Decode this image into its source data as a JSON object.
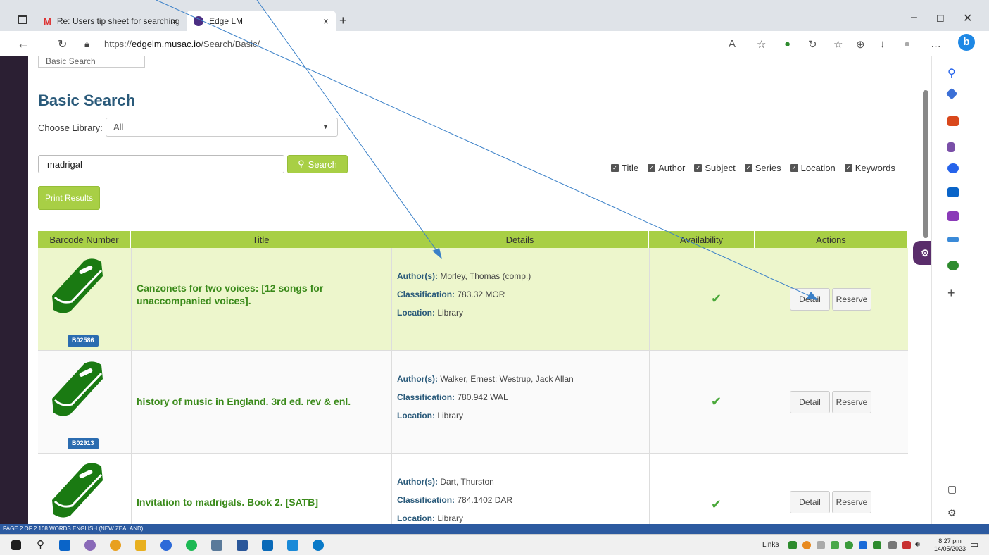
{
  "browser": {
    "tabs": [
      {
        "label": "Re: Users tip sheet for searching",
        "close": "×"
      },
      {
        "label": "Edge LM",
        "close": "×"
      }
    ],
    "new_tab": "+",
    "url_prefix": "https://",
    "url_host": "edgelm.musac.io",
    "url_path": "/Search/Basic/"
  },
  "page": {
    "mode_select": "Basic Search",
    "title": "Basic Search",
    "choose_library_label": "Choose Library:",
    "library_value": "All",
    "search_value": "madrigal",
    "search_button": "Search",
    "filters": [
      "Title",
      "Author",
      "Subject",
      "Series",
      "Location",
      "Keywords"
    ],
    "print_button": "Print Results"
  },
  "table": {
    "columns": [
      "Barcode Number",
      "Title",
      "Details",
      "Availability",
      "Actions"
    ],
    "rows": [
      {
        "barcode": "B02586",
        "title": "Canzonets for two voices: [12 songs for unaccompanied voices].",
        "author_label": "Author(s):",
        "author": "Morley, Thomas (comp.)",
        "class_label": "Classification:",
        "classification": "783.32 MOR",
        "loc_label": "Location:",
        "location": "Library",
        "available": "✔",
        "detail": "Detail",
        "reserve": "Reserve"
      },
      {
        "barcode": "B02913",
        "title": "history of music in England. 3rd ed. rev & enl.",
        "author_label": "Author(s):",
        "author": "Walker, Ernest; Westrup, Jack Allan",
        "class_label": "Classification:",
        "classification": "780.942 WAL",
        "loc_label": "Location:",
        "location": "Library",
        "available": "✔",
        "detail": "Detail",
        "reserve": "Reserve"
      },
      {
        "barcode": "",
        "title": "Invitation to madrigals. Book 2. [SATB]",
        "author_label": "Author(s):",
        "author": "Dart, Thurston",
        "class_label": "Classification:",
        "classification": "784.1402 DAR",
        "loc_label": "Location:",
        "location": "Library",
        "available": "✔",
        "detail": "Detail",
        "reserve": "Reserve"
      }
    ]
  },
  "statusbar": {
    "word_status": "PAGE 2 OF 2   108 WORDS   ENGLISH (NEW ZEALAND)"
  },
  "taskbar": {
    "links": "Links",
    "time": "8:27 pm",
    "date": "14/05/2023"
  },
  "colors": {
    "accent": "#a8cf45",
    "title_blue": "#2a5a7a",
    "book_green": "#1a7a12",
    "barcode_blue": "#2b6cb0"
  }
}
